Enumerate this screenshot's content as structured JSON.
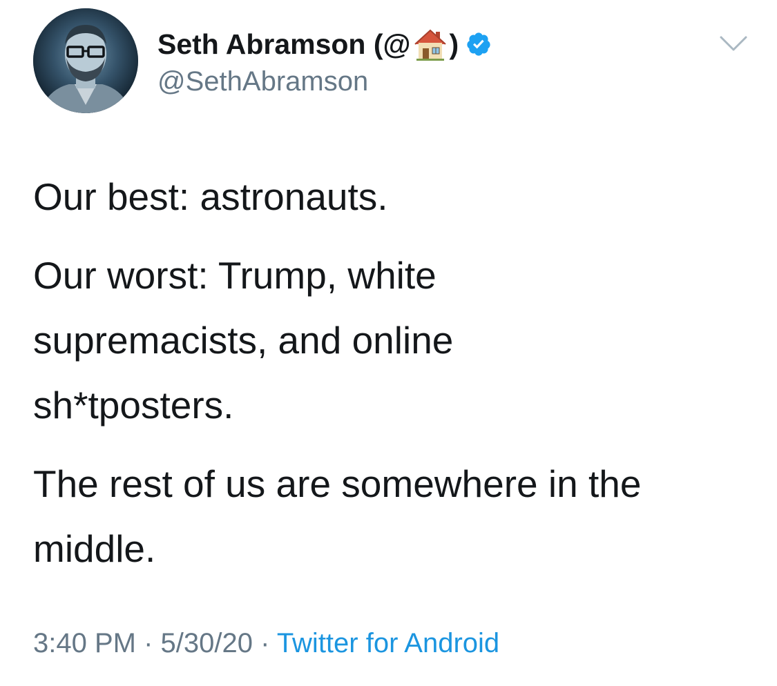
{
  "author": {
    "display_name_prefix": "Seth Abramson (@",
    "display_name_suffix": ")",
    "handle": "@SethAbramson",
    "verified": true,
    "house_emoji": "house-icon"
  },
  "tweet": {
    "paragraphs": [
      "Our best: astronauts.",
      "Our worst: Trump, white supremacists, and online sh*tposters.",
      "The rest of us are somewhere in the middle."
    ]
  },
  "footer": {
    "time": "3:40 PM",
    "separator": " · ",
    "date": "5/30/20",
    "source": "Twitter for Android"
  },
  "colors": {
    "text": "#14171a",
    "secondary": "#657786",
    "link": "#1b95e0",
    "verified": "#1da1f2"
  },
  "icons": {
    "menu": "chevron-down-icon",
    "verified": "verified-badge-icon"
  }
}
